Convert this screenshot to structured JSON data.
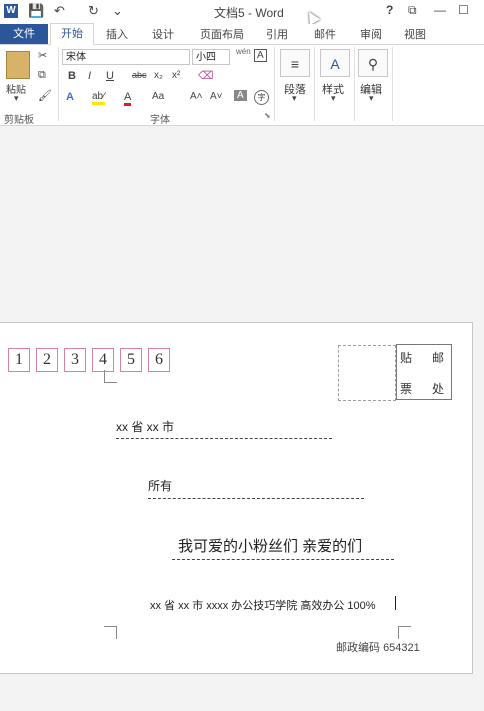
{
  "window": {
    "title": "文档5 - Word",
    "help": "?",
    "restore_ribbon": "⧉",
    "minimize": "—",
    "maximize": "☐"
  },
  "qat": {
    "save": "💾",
    "undo": "↶",
    "redo": "↻",
    "more": "⌄"
  },
  "tabs": {
    "file": "文件",
    "home": "开始",
    "insert": "插入",
    "design": "设计",
    "layout": "页面布局",
    "references": "引用",
    "mailings": "邮件",
    "review": "审阅",
    "view": "视图"
  },
  "ribbon": {
    "clipboard": {
      "paste": "粘贴",
      "label": "剪贴板"
    },
    "font": {
      "name": "宋体",
      "size": "小四",
      "bold": "B",
      "italic": "I",
      "underline": "U",
      "strike": "abc",
      "subscript": "x₂",
      "superscript": "x²",
      "text_effects": "A",
      "highlight": "ab⁄",
      "font_color": "A",
      "change_case": "Aa",
      "grow": "A˄",
      "shrink": "A˅",
      "shading": "A",
      "enclose": "字",
      "pinyin": "wén",
      "char_border": "A",
      "label": "字体"
    },
    "paragraph": {
      "label": "段落"
    },
    "styles": {
      "label": "样式"
    },
    "editing": {
      "label": "编辑"
    }
  },
  "document": {
    "zip_digits": [
      "1",
      "2",
      "3",
      "4",
      "5",
      "6"
    ],
    "stamp": [
      "贴",
      "邮",
      "票",
      "处"
    ],
    "address": "xx 省 xx 市",
    "recipient": "所有",
    "greeting": "我可爱的小粉丝们  亲爱的们",
    "sender": "xx 省 xx 市 xxxx  办公技巧学院  高效办公 100%",
    "postal_code_label": "邮政编码",
    "postal_code": "654321"
  }
}
